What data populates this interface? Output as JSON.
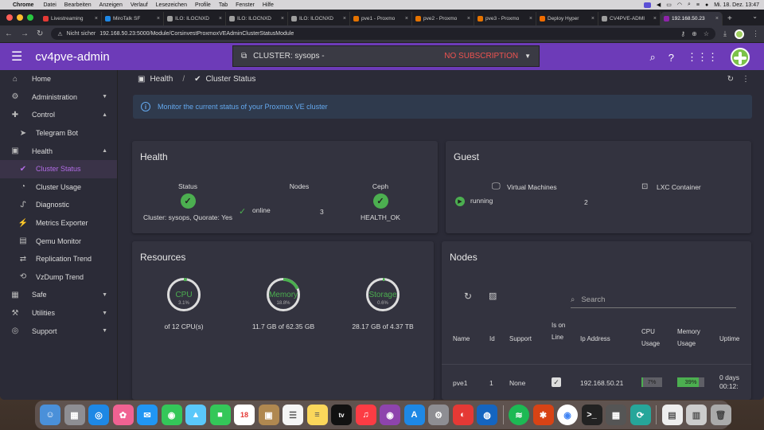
{
  "menubar": {
    "app": "Chrome",
    "items": [
      "Datei",
      "Bearbeiten",
      "Anzeigen",
      "Verlauf",
      "Lesezeichen",
      "Profile",
      "Tab",
      "Fenster",
      "Hilfe"
    ],
    "clock": "Mi. 18. Dez. 13:47"
  },
  "browser": {
    "tabs": [
      {
        "label": "Livestreaming",
        "color": "#e53935"
      },
      {
        "label": "MiroTalk SF",
        "color": "#1e88e5"
      },
      {
        "label": "ILO: ILOCNXD",
        "color": "#9e9e9e"
      },
      {
        "label": "ILO: ILOCNXD",
        "color": "#9e9e9e"
      },
      {
        "label": "ILO: ILOCNXD",
        "color": "#9e9e9e"
      },
      {
        "label": "pve1 - Proxmo",
        "color": "#e57300"
      },
      {
        "label": "pve2 - Proxmo",
        "color": "#e57300"
      },
      {
        "label": "pve3 - Proxmo",
        "color": "#e57300"
      },
      {
        "label": "Deploy Hyper",
        "color": "#ef6c00"
      },
      {
        "label": "CV4PVE-ADMI",
        "color": "#9e9e9e"
      },
      {
        "label": "192.168.50.23",
        "color": "#8e24aa"
      }
    ],
    "security": "Nicht sicher",
    "url": "192.168.50.23:5000/Module/CorsinvestProxmoxVEAdminClusterStatusModule"
  },
  "app": {
    "title": "cv4pve-admin",
    "cluster_label": "CLUSTER: sysops -",
    "subscription": "NO SUBSCRIPTION",
    "accent": "#6d3bb8"
  },
  "sidebar": {
    "items": [
      {
        "label": "Home",
        "icon": "home-icon",
        "glyph": "⌂"
      },
      {
        "label": "Administration",
        "icon": "admin-icon",
        "glyph": "⚙"
      },
      {
        "label": "Control",
        "icon": "gamepad-icon",
        "glyph": "✚"
      },
      {
        "label": "Telegram Bot",
        "icon": "telegram-icon",
        "glyph": "➤"
      },
      {
        "label": "Health",
        "icon": "health-icon",
        "glyph": "▣"
      },
      {
        "label": "Cluster Status",
        "icon": "check-badge-icon",
        "glyph": "✔"
      },
      {
        "label": "Cluster Usage",
        "icon": "usage-icon",
        "glyph": "◔"
      },
      {
        "label": "Diagnostic",
        "icon": "stethoscope-icon",
        "glyph": "ᔑ"
      },
      {
        "label": "Metrics Exporter",
        "icon": "metrics-icon",
        "glyph": "⚡"
      },
      {
        "label": "Qemu Monitor",
        "icon": "monitor-icon",
        "glyph": "▤"
      },
      {
        "label": "Replication Trend",
        "icon": "replication-icon",
        "glyph": "⇄"
      },
      {
        "label": "VzDump Trend",
        "icon": "vzdump-icon",
        "glyph": "⟲"
      },
      {
        "label": "Safe",
        "icon": "safe-icon",
        "glyph": "▦"
      },
      {
        "label": "Utilities",
        "icon": "utilities-icon",
        "glyph": "⚒"
      },
      {
        "label": "Support",
        "icon": "support-icon",
        "glyph": "◎"
      }
    ]
  },
  "breadcrumb": {
    "parent": "Health",
    "current": "Cluster Status"
  },
  "info_text": "Monitor the current status of your Proxmox VE cluster",
  "health": {
    "title": "Health",
    "status_header": "Status",
    "status_text": "Cluster: sysops, Quorate: Yes",
    "nodes_header": "Nodes",
    "nodes_state": "online",
    "nodes_count": "3",
    "ceph_header": "Ceph",
    "ceph_text": "HEALTH_OK"
  },
  "guest": {
    "title": "Guest",
    "vm_header": "Virtual Machines",
    "vm_state": "running",
    "vm_count": "2",
    "lxc_header": "LXC Container"
  },
  "resources": {
    "title": "Resources",
    "cpu": {
      "label": "CPU",
      "pct_text": "3.1%",
      "pct": 3.1,
      "caption": "of 12 CPU(s)"
    },
    "memory": {
      "label": "Memory",
      "pct_text": "18.8%",
      "pct": 18.8,
      "caption": "11.7 GB of 62.35 GB"
    },
    "storage": {
      "label": "Storage",
      "pct_text": "0.6%",
      "pct": 0.6,
      "caption": "28.17 GB of 4.37 TB"
    }
  },
  "nodes": {
    "title": "Nodes",
    "search_placeholder": "Search",
    "headers": {
      "name": "Name",
      "id": "Id",
      "support": "Support",
      "online": "Is on Line",
      "ip": "Ip Address",
      "cpu": "CPU Usage",
      "memory": "Memory Usage",
      "uptime": "Uptime"
    },
    "rows": [
      {
        "name": "pve1",
        "id": "1",
        "support": "None",
        "ip": "192.168.50.21",
        "cpu_text": "7%",
        "cpu": 7,
        "mem_text": "39%",
        "mem": 39,
        "uptime": "0 days 00:12:"
      }
    ]
  }
}
